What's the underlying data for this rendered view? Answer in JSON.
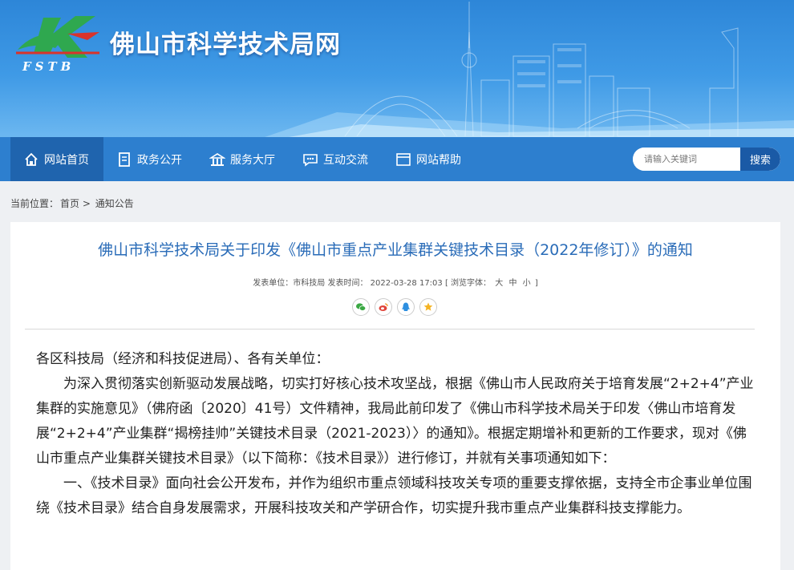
{
  "header": {
    "site_title": "佛山市科学技术局网",
    "logo_text": "FSTB"
  },
  "nav": {
    "items": [
      {
        "label": "网站首页",
        "icon": "home-icon",
        "active": true
      },
      {
        "label": "政务公开",
        "icon": "document-icon",
        "active": false
      },
      {
        "label": "服务大厅",
        "icon": "hall-icon",
        "active": false
      },
      {
        "label": "互动交流",
        "icon": "chat-icon",
        "active": false
      },
      {
        "label": "网站帮助",
        "icon": "window-icon",
        "active": false
      }
    ],
    "search_placeholder": "请输入关键词",
    "search_button": "搜索"
  },
  "breadcrumb": {
    "prefix": "当前位置：",
    "home": "首页",
    "separator": ">",
    "current": "通知公告"
  },
  "article": {
    "title": "佛山市科学技术局关于印发《佛山市重点产业集群关键技术目录（2022年修订）》的通知",
    "meta_unit_label": "发表单位：",
    "meta_unit": "市科技局",
    "meta_time_label": "发表时间：",
    "meta_time": "2022-03-28 17:03",
    "meta_font_label": "[ 浏览字体：",
    "font_large": "大",
    "font_medium": "中",
    "font_small": "小",
    "meta_font_end": "]",
    "share_icons": [
      "wechat-icon",
      "weibo-icon",
      "qq-icon",
      "favorite-icon"
    ],
    "salutation": "各区科技局（经济和科技促进局）、各有关单位：",
    "para1": "为深入贯彻落实创新驱动发展战略，切实打好核心技术攻坚战，根据《佛山市人民政府关于培育发展“2+2+4”产业集群的实施意见》（佛府函〔2020〕41号）文件精神，我局此前印发了《佛山市科学技术局关于印发〈佛山市培育发展“2+2+4”产业集群“揭榜挂帅”关键技术目录（2021-2023）〉的通知》。根据定期增补和更新的工作要求，现对《佛山市重点产业集群关键技术目录》（以下简称：《技术目录》）进行修订，并就有关事项通知如下：",
    "para2": "一、《技术目录》面向社会公开发布，并作为组织市重点领域科技攻关专项的重要支撑依据，支持全市企事业单位围绕《技术目录》结合自身发展需求，开展科技攻关和产学研合作，切实提升我市重点产业集群科技支撑能力。"
  },
  "colors": {
    "banner": "#3f9ae6",
    "nav": "#2d7fcf",
    "nav_active": "#1f64ae",
    "title": "#2a6cb8",
    "logo_green": "#2fa84f",
    "logo_red": "#d9332b"
  }
}
